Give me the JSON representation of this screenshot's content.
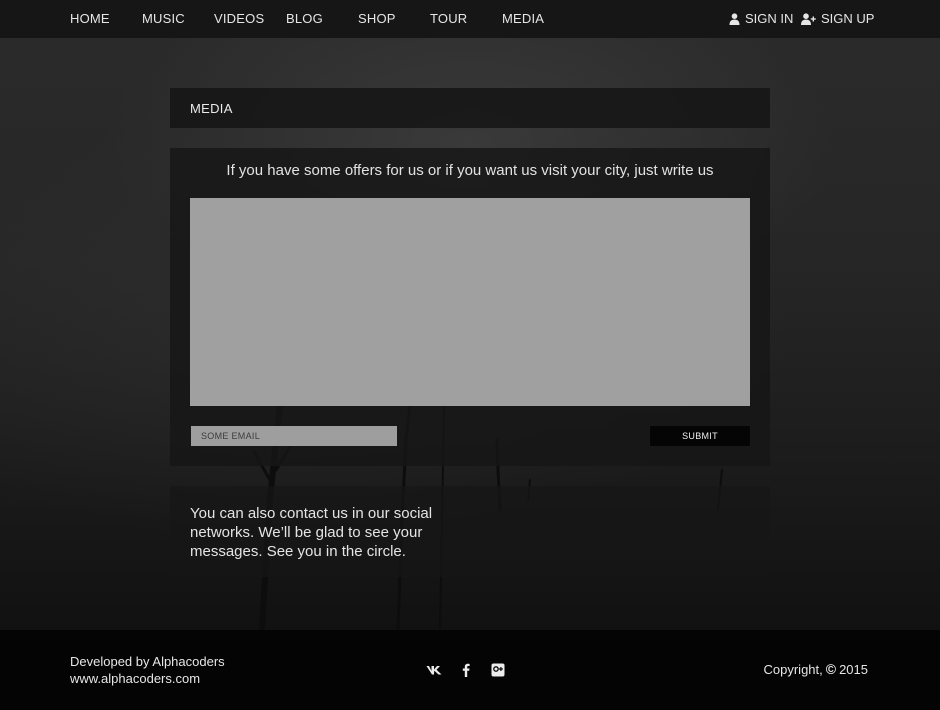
{
  "nav": {
    "items": [
      {
        "label": "HOME"
      },
      {
        "label": "MUSIC"
      },
      {
        "label": "VIDEOS"
      },
      {
        "label": "BLOG"
      },
      {
        "label": "SHOP"
      },
      {
        "label": "TOUR"
      },
      {
        "label": "MEDIA"
      }
    ],
    "sign_in": {
      "label": "SIGN IN",
      "icon": "user-icon"
    },
    "sign_up": {
      "label": "SIGN UP",
      "icon": "user-plus-icon"
    }
  },
  "page": {
    "title": "MEDIA"
  },
  "contact_form": {
    "intro": "If you have some offers for us or if you want us visit your city, just write us",
    "message_value": "",
    "email_placeholder": "SOME EMAIL",
    "submit_label": "SUBMIT"
  },
  "social_note": {
    "text": "You can also contact us in our social networks. We’ll be glad to see your messages. See you in the circle."
  },
  "footer": {
    "developer": "Developed by Alphacoders",
    "site": "www.alphacoders.com",
    "social_icons": [
      "vk-icon",
      "facebook-icon",
      "google-plus-icon"
    ],
    "copyright_label": "Copyright,",
    "copyright_symbol": "©",
    "year": "2015"
  },
  "colors": {
    "background": "#1b1b1b",
    "panel": "#161616",
    "textarea": "#a0a0a0",
    "button": "#050505",
    "footer": "#040404",
    "text": "#e6e6e6"
  }
}
